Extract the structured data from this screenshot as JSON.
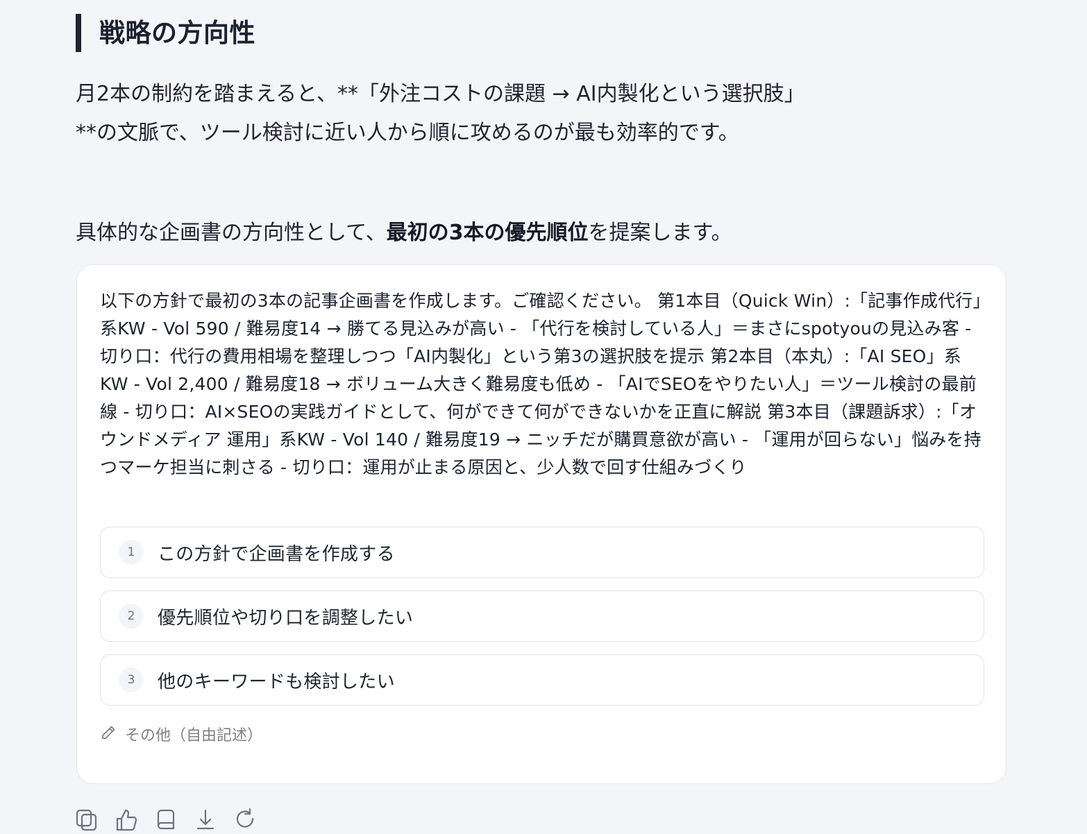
{
  "heading": {
    "title": "戦略の方向性"
  },
  "paragraphs": {
    "p1": "月2本の制約を踏まえると、**「外注コストの課題 → AI内製化という選択肢」**の文脈で、ツール検討に近い人から順に攻めるのが最も効率的です。",
    "p2_pre": "具体的な企画書の方向性として、",
    "p2_bold": "最初の3本の優先順位",
    "p2_post": "を提案します。"
  },
  "question": {
    "body": "以下の方針で最初の3本の記事企画書を作成します。ご確認ください。 第1本目（Quick Win）:「記事作成代行」系KW - Vol 590 / 難易度14 → 勝てる見込みが高い - 「代行を検討している人」＝まさにspotyouの見込み客 - 切り口：代行の費用相場を整理しつつ「AI内製化」という第3の選択肢を提示 第2本目（本丸）:「AI SEO」系KW - Vol 2,400 / 難易度18 → ボリューム大きく難易度も低め - 「AIでSEOをやりたい人」＝ツール検討の最前線 - 切り口：AI×SEOの実践ガイドとして、何ができて何ができないかを正直に解説 第3本目（課題訴求）:「オウンドメディア 運用」系KW - Vol 140 / 難易度19 → ニッチだが購買意欲が高い - 「運用が回らない」悩みを持つマーケ担当に刺さる - 切り口：運用が止まる原因と、少人数で回す仕組みづくり",
    "options": [
      {
        "num": "1",
        "label": "この方針で企画書を作成する"
      },
      {
        "num": "2",
        "label": "優先順位や切り口を調整したい"
      },
      {
        "num": "3",
        "label": "他のキーワードも検討したい"
      }
    ],
    "other_label": "その他（自由記述）"
  },
  "actions": {
    "icons": [
      "copy-icon",
      "thumbs-up-icon",
      "bookmark-icon",
      "download-icon",
      "refresh-icon"
    ]
  }
}
